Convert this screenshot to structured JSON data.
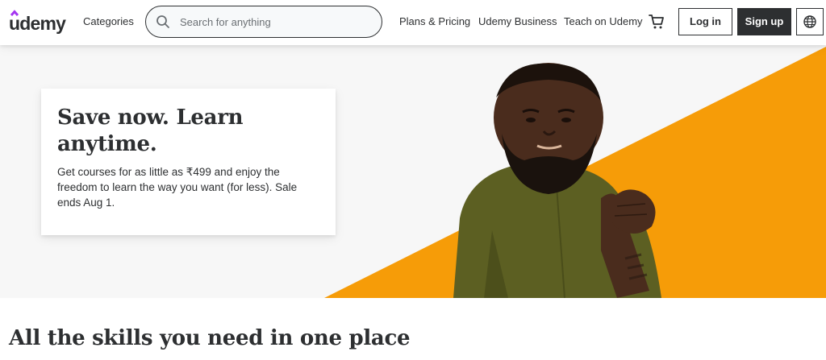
{
  "brand": {
    "name": "udemy",
    "accent_color": "#a435f0"
  },
  "header": {
    "categories_label": "Categories",
    "search": {
      "placeholder": "Search for anything",
      "value": "",
      "icon": "search-icon"
    },
    "nav": {
      "plans_pricing": "Plans & Pricing",
      "business": "Udemy Business",
      "teach": "Teach on Udemy"
    },
    "cart_icon": "shopping-cart-icon",
    "login_label": "Log in",
    "signup_label": "Sign up",
    "language_icon": "globe-icon"
  },
  "hero": {
    "background_color": "#f7f7f7",
    "accent_color": "#f69c08",
    "title": "Save now. Learn anytime.",
    "text": "Get courses for as little as ₹499 and enjoy the freedom to learn the way you want (for less). Sale ends Aug 1."
  },
  "section": {
    "title": "All the skills you need in one place"
  }
}
